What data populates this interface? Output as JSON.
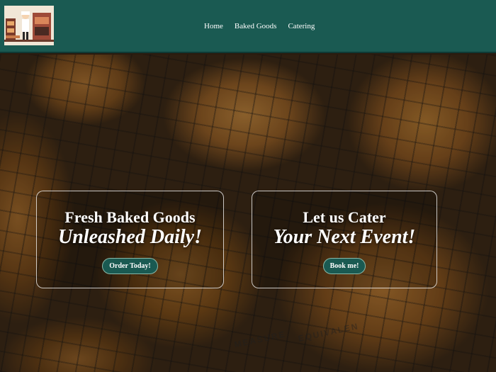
{
  "nav": {
    "logo_icon": "baker-kitchen-logo",
    "links": [
      {
        "label": "Home"
      },
      {
        "label": "Baked Goods"
      },
      {
        "label": "Catering"
      }
    ]
  },
  "hero": {
    "background": "muffins-on-cooling-rack-photo",
    "rack_text": [
      "MEASURE",
      "EQUIVALEN"
    ],
    "cards": [
      {
        "line1": "Fresh Baked Goods",
        "line2": "Unleashed Daily!",
        "button": "Order Today!"
      },
      {
        "line1": "Let us Cater",
        "line2": "Your Next Event!",
        "button": "Book me!"
      }
    ]
  },
  "colors": {
    "nav_bg": "#1a5a52",
    "button_bg": "#1a5a52",
    "text": "#ffffff"
  }
}
